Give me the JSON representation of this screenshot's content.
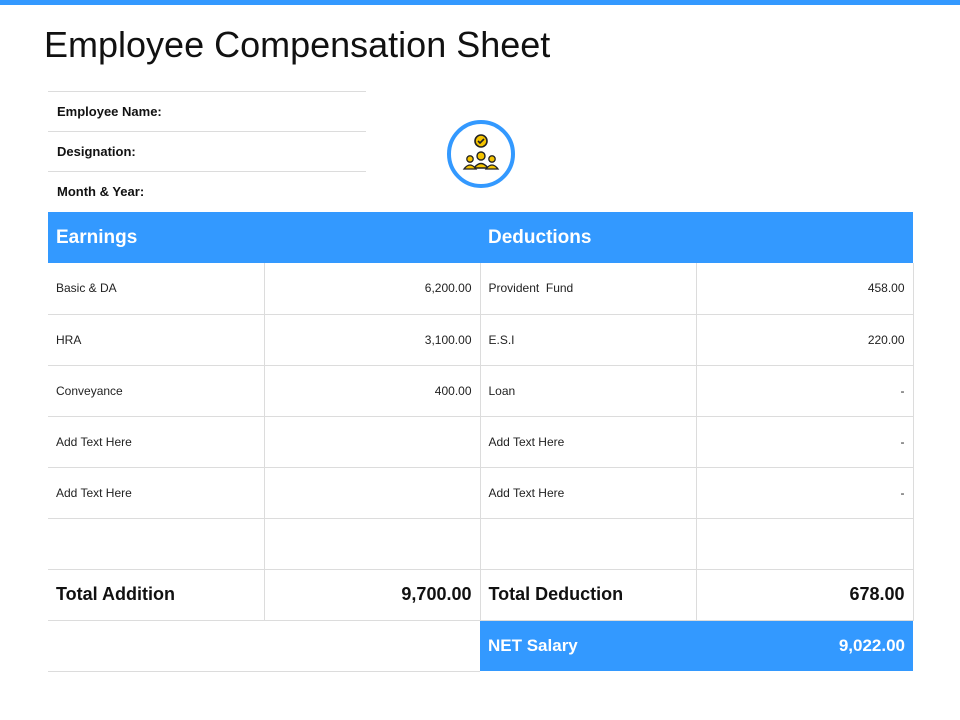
{
  "title": "Employee Compensation Sheet",
  "accent_color": "#3399ff",
  "info_fields": [
    "Employee Name:",
    "Designation:",
    "Month & Year:"
  ],
  "emblem_icon": "team-approval-icon",
  "headers": {
    "earnings": "Earnings",
    "deductions": "Deductions"
  },
  "rows": [
    {
      "earning": "Basic & DA",
      "earning_amount": "6,200.00",
      "deduction": "Provident  Fund",
      "deduction_amount": "458.00"
    },
    {
      "earning": "HRA",
      "earning_amount": "3,100.00",
      "deduction": "E.S.I",
      "deduction_amount": "220.00"
    },
    {
      "earning": "Conveyance",
      "earning_amount": "400.00",
      "deduction": "Loan",
      "deduction_amount": "-"
    },
    {
      "earning": "Add Text Here",
      "earning_amount": "",
      "deduction": "Add Text Here",
      "deduction_amount": "-"
    },
    {
      "earning": "Add Text Here",
      "earning_amount": "",
      "deduction": "Add Text Here",
      "deduction_amount": "-"
    },
    {
      "earning": "",
      "earning_amount": "",
      "deduction": "",
      "deduction_amount": ""
    }
  ],
  "totals": {
    "addition_label": "Total Addition",
    "addition_value": "9,700.00",
    "deduction_label": "Total Deduction",
    "deduction_value": "678.00"
  },
  "net": {
    "label": "NET Salary",
    "value": "9,022.00"
  }
}
